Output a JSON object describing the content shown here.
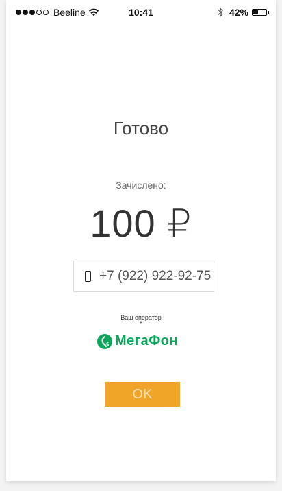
{
  "status_bar": {
    "carrier": "Beeline",
    "time": "10:41",
    "battery_percent": "42%",
    "battery_level": 0.42,
    "signal_bars_filled": 3,
    "signal_bars_total": 5
  },
  "main": {
    "title": "Готово",
    "credited_label": "Зачислено:",
    "amount": "100 ₽",
    "phone_number": "+7 (922) 922-92-75",
    "operator_label": "Ваш оператор",
    "operator_arrow": "▼",
    "operator_name": "МегаФон",
    "ok_label": "OK"
  },
  "colors": {
    "accent_button": "#f0a528",
    "operator_brand": "#0aa65a"
  }
}
